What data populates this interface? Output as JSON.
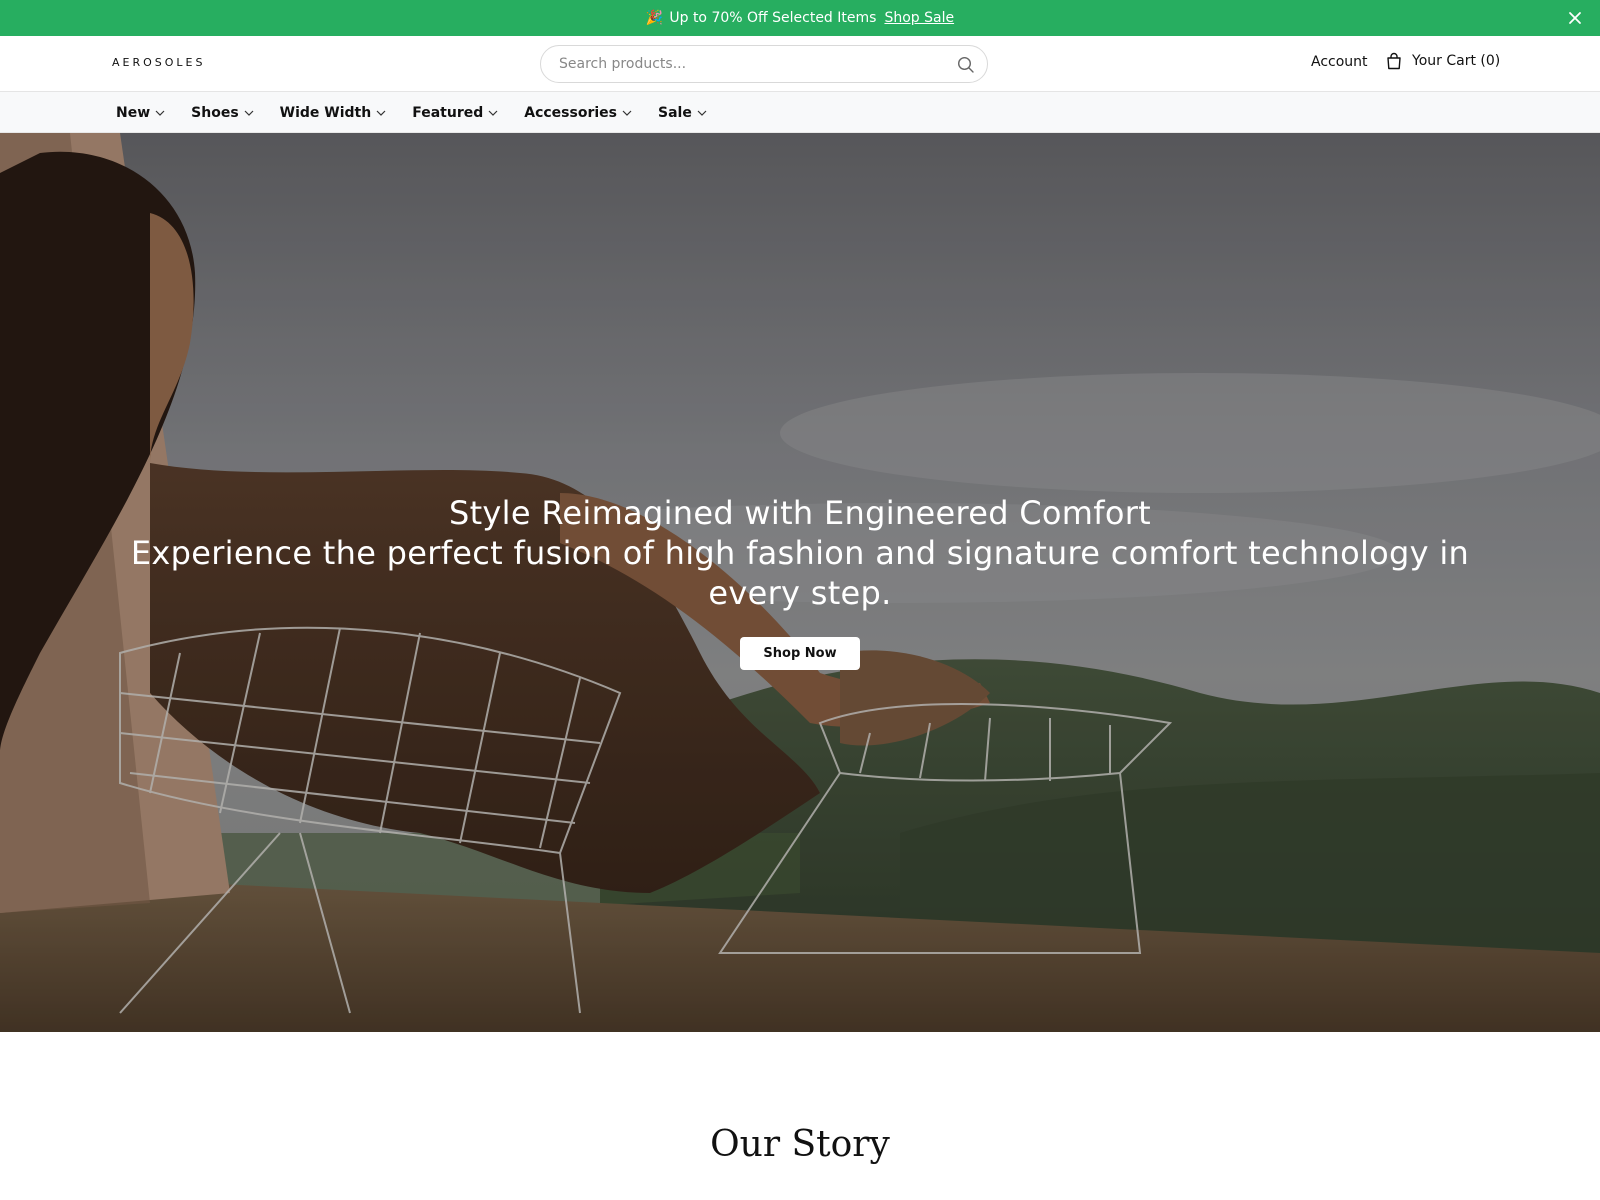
{
  "announcement": {
    "emoji": "🎉",
    "text": "Up to 70% Off Selected Items",
    "link": "Shop Sale",
    "close_icon": "close-icon",
    "background_color": "#27ae60"
  },
  "header": {
    "logo": "AEROSOLES",
    "search": {
      "placeholder": "Search products...",
      "value": "",
      "icon": "search-icon"
    },
    "account_label": "Account",
    "cart_label": "Your Cart (0)",
    "cart_icon": "shopping-bag-icon"
  },
  "nav": {
    "items": [
      {
        "label": "New",
        "icon": "chevron-down-icon"
      },
      {
        "label": "Shoes",
        "icon": "chevron-down-icon"
      },
      {
        "label": "Wide Width",
        "icon": "chevron-down-icon"
      },
      {
        "label": "Featured",
        "icon": "chevron-down-icon"
      },
      {
        "label": "Accessories",
        "icon": "chevron-down-icon"
      },
      {
        "label": "Sale",
        "icon": "chevron-down-icon"
      }
    ]
  },
  "hero": {
    "title": "Style Reimagined with Engineered Comfort",
    "subtitle": "Experience the perfect fusion of high fashion and signature comfort technology in every step.",
    "button_label": "Shop Now"
  },
  "story": {
    "title": "Our Story"
  }
}
